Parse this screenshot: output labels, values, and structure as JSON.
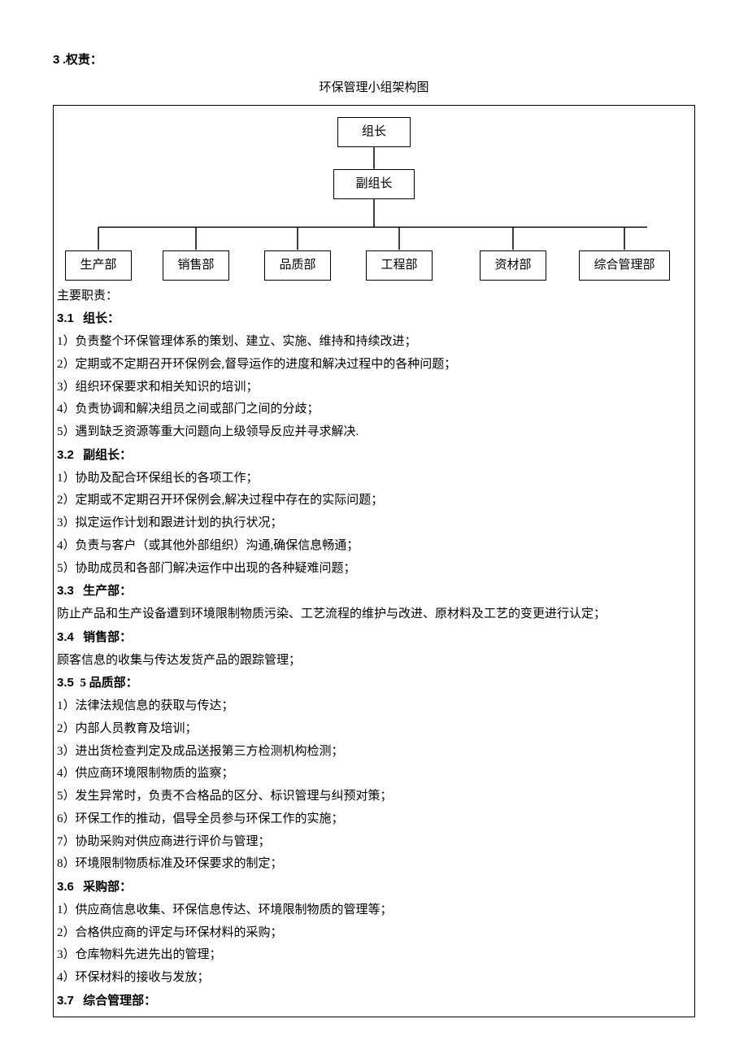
{
  "top_section": {
    "num": "3",
    "label": ".权责："
  },
  "chart_title": "环保管理小组架构图",
  "chart_data": {
    "type": "org-chart",
    "root": "组长",
    "level2": "副组长",
    "leaves": [
      "生产部",
      "销售部",
      "品质部",
      "工程部",
      "资材部",
      "综合管理部"
    ]
  },
  "main_heading": "主要职责：",
  "sections": {
    "s31": {
      "num": "3.1",
      "title": "组长：",
      "items": [
        "1）负责整个环保管理体系的策划、建立、实施、维持和持续改进；",
        "2）定期或不定期召开环保例会,督导运作的进度和解决过程中的各种问题；",
        "3）组织环保要求和相关知识的培训；",
        "4）负责协调和解决组员之间或部门之间的分歧；",
        "5）遇到缺乏资源等重大问题向上级领导反应并寻求解决."
      ]
    },
    "s32": {
      "num": "3.2",
      "title": "副组长：",
      "items": [
        "1）协助及配合环保组长的各项工作；",
        "2）定期或不定期召开环保例会,解决过程中存在的实际问题；",
        "3）拟定运作计划和跟进计划的执行状况；",
        "4）负责与客户（或其他外部组织）沟通,确保信息畅通；",
        "5）协助成员和各部门解决运作中出现的各种疑难问题；"
      ]
    },
    "s33": {
      "num": "3.3",
      "title": "生产部：",
      "body": "防止产品和生产设备遭到环境限制物质污染、工艺流程的维护与改进、原材料及工艺的变更进行认定；"
    },
    "s34": {
      "num": "3.4",
      "title": "销售部：",
      "body": "顾客信息的收集与传达发货产品的跟踪管理；"
    },
    "s35": {
      "num": "3.5",
      "title": "5 品质部：",
      "items": [
        "1）法律法规信息的获取与传达；",
        "2）内部人员教育及培训；",
        "3）进出货检查判定及成品送报第三方检测机构检测；",
        "4）供应商环境限制物质的监察；",
        "5）发生异常时，负责不合格品的区分、标识管理与纠预对策；",
        "6）环保工作的推动，倡导全员参与环保工作的实施；",
        "7）协助采购对供应商进行评价与管理；",
        "8）环境限制物质标准及环保要求的制定；"
      ]
    },
    "s36": {
      "num": "3.6",
      "title": "采购部：",
      "items": [
        "1）供应商信息收集、环保信息传达、环境限制物质的管理等；",
        "2）合格供应商的评定与环保材料的采购；",
        "3）仓库物料先进先出的管理；",
        "4）环保材料的接收与发放；"
      ]
    },
    "s37": {
      "num": "3.7",
      "title": "综合管理部："
    }
  }
}
